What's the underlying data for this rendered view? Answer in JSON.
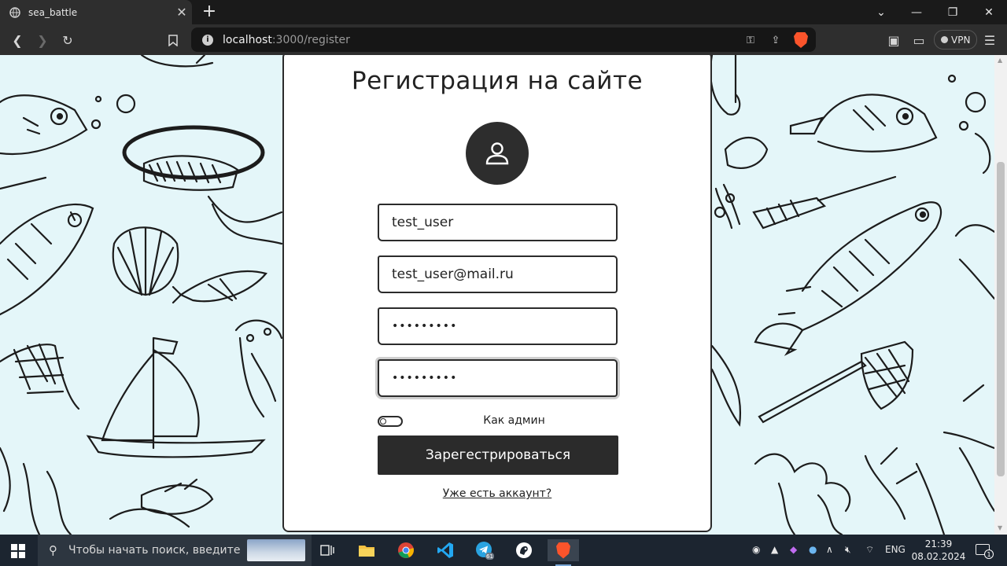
{
  "browser": {
    "tab_title": "sea_battle",
    "url_host": "localhost",
    "url_path": ":3000/register",
    "vpn_label": "VPN"
  },
  "page": {
    "heading": "Регистрация на сайте",
    "fields": {
      "username_value": "test_user",
      "email_value": "test_user@mail.ru",
      "password_masked": "•••••••••",
      "confirm_masked": "•••••••••"
    },
    "admin_toggle_label": "Как админ",
    "submit_label": "Зарегестрироваться",
    "login_link": "Уже есть аккаунт?",
    "colors": {
      "accent": "#2b2b2b",
      "background": "#e4f6f9"
    }
  },
  "taskbar": {
    "search_placeholder": "Чтобы начать поиск, введите",
    "lang": "ENG",
    "time": "21:39",
    "date": "08.02.2024",
    "telegram_badge": "61",
    "notification_count": "1"
  }
}
